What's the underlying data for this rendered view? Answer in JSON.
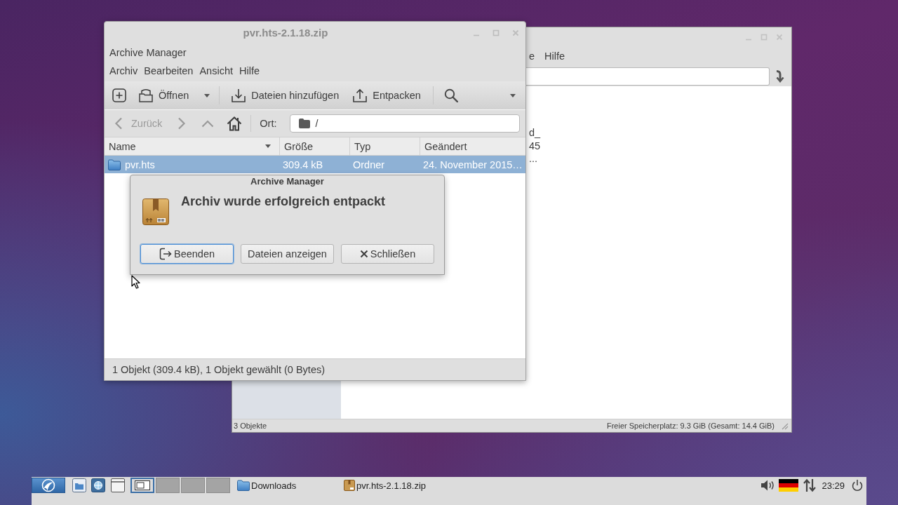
{
  "background_window": {
    "menu": [
      "e",
      "Hilfe"
    ],
    "file_labels": [
      "d_",
      "45",
      "..."
    ],
    "status_left": "3 Objekte",
    "status_right": "Freier Speicherplatz: 9.3 GiB (Gesamt: 14.4 GiB)"
  },
  "archive_window": {
    "title": "pvr.hts-2.1.18.zip",
    "active": false,
    "app_menu": "Archive Manager",
    "menu": [
      "Archiv",
      "Bearbeiten",
      "Ansicht",
      "Hilfe"
    ],
    "toolbar": [
      {
        "kind": "new"
      },
      {
        "kind": "open",
        "label": "Öffnen"
      },
      {
        "kind": "add",
        "label": "Dateien hinzufügen"
      },
      {
        "kind": "extract",
        "label": "Entpacken"
      },
      {
        "kind": "search"
      }
    ],
    "nav": [
      {
        "kind": "back",
        "label": "Zurück",
        "disabled": true
      },
      {
        "kind": "forward",
        "disabled": true
      },
      {
        "kind": "up",
        "disabled": true
      },
      {
        "kind": "home",
        "disabled": false
      }
    ],
    "location": {
      "label": "Ort:",
      "value": "/"
    },
    "columns": [
      {
        "label": "Name",
        "sorted": true
      },
      {
        "label": "Größe",
        "sorted": false
      },
      {
        "label": "Typ",
        "sorted": false
      },
      {
        "label": "Geändert",
        "sorted": false
      }
    ],
    "rows": [
      {
        "name": "pvr.hts",
        "size": "309.4 kB",
        "type": "Ordner",
        "modified": "24. November 2015…",
        "selected": true
      }
    ],
    "status": "1 Objekt (309.4 kB), 1 Objekt gewählt (0 Bytes)"
  },
  "dialog": {
    "title": "Archive Manager",
    "message": "Archiv wurde erfolgreich entpackt",
    "buttons": [
      {
        "kind": "quit",
        "label": "Beenden",
        "focused": true
      },
      {
        "kind": "plain",
        "label": "Dateien anzeigen",
        "focused": false
      },
      {
        "kind": "close",
        "label": "Schließen",
        "focused": false
      }
    ]
  },
  "taskbar": {
    "workspaces": [
      {
        "selected": true
      },
      {
        "selected": false
      },
      {
        "selected": false
      },
      {
        "selected": false
      }
    ],
    "tasks": [
      {
        "kind": "folder",
        "label": "Downloads"
      },
      {
        "kind": "archive",
        "label": "pvr.hts-2.1.18.zip"
      }
    ],
    "clock": "23:29"
  }
}
